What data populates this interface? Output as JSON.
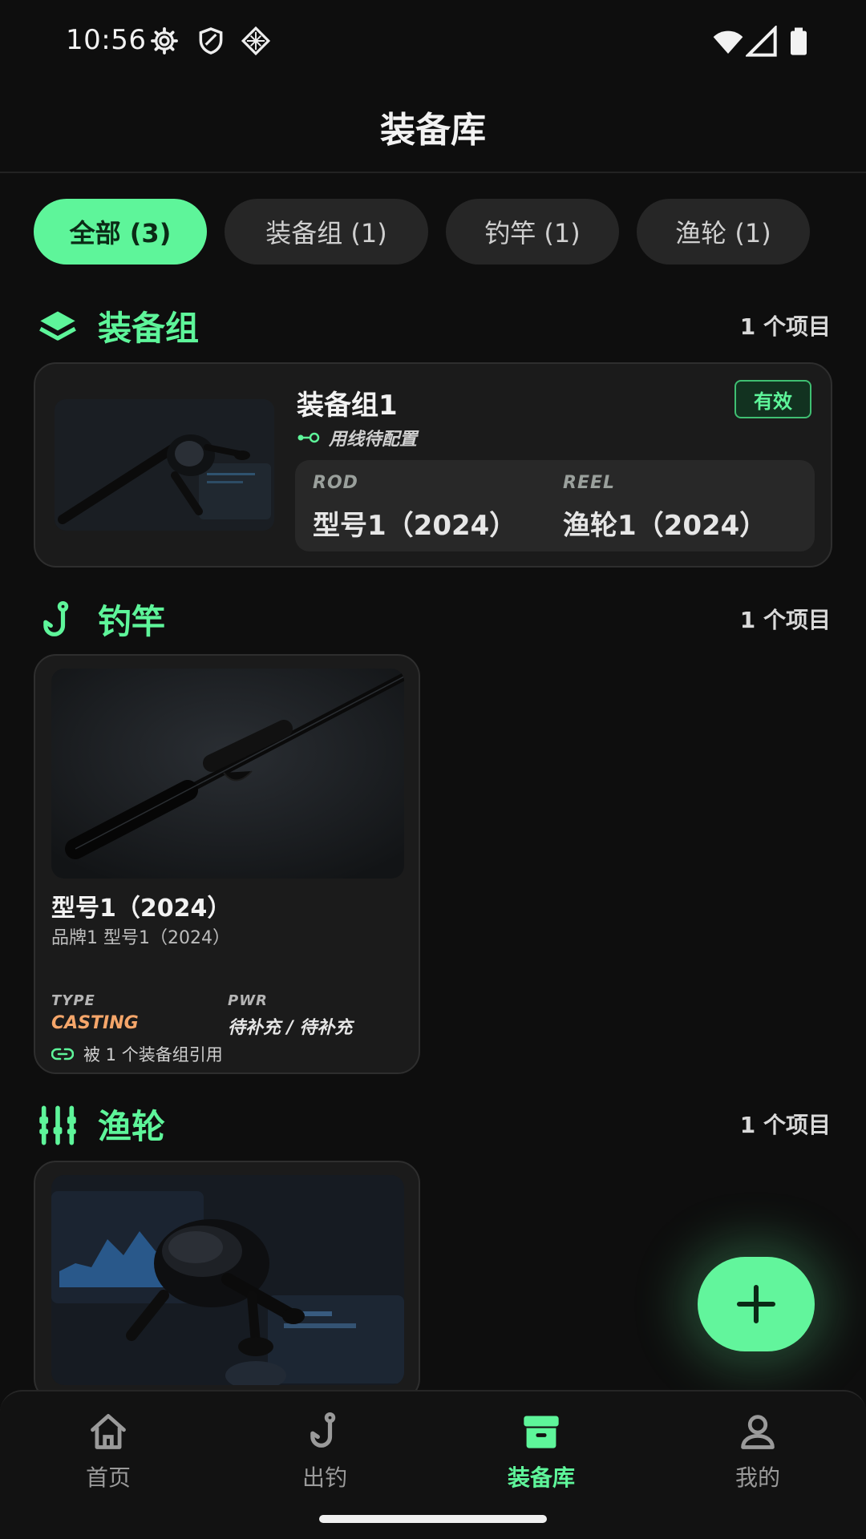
{
  "status_bar": {
    "time": "10:56",
    "icons": [
      "gear-icon",
      "shield-icon",
      "grid-diamond-icon",
      "wifi-icon",
      "signal-icon",
      "battery-icon"
    ]
  },
  "header": {
    "title": "装备库"
  },
  "filters": [
    {
      "label": "全部 (3)",
      "active": true
    },
    {
      "label": "装备组 (1)",
      "active": false
    },
    {
      "label": "钓竿 (1)",
      "active": false
    },
    {
      "label": "渔轮 (1)",
      "active": false
    }
  ],
  "sections": {
    "sets": {
      "title": "装备组",
      "count": "1 个项目",
      "icon": "layers-icon",
      "card": {
        "name": "装备组1",
        "badge": "有效",
        "line_status": "用线待配置",
        "rod_label": "ROD",
        "rod_value": "型号1（2024）",
        "reel_label": "REEL",
        "reel_value": "渔轮1（2024）"
      }
    },
    "rods": {
      "title": "钓竿",
      "count": "1 个项目",
      "icon": "hook-icon",
      "card": {
        "name": "型号1（2024）",
        "sub": "品牌1 型号1（2024）",
        "type_label": "TYPE",
        "type_value": "CASTING",
        "pwr_label": "PWR",
        "pwr_value": "待补充 / 待补充",
        "ref_text": "被 1 个装备组引用"
      }
    },
    "reels": {
      "title": "渔轮",
      "count": "1 个项目",
      "icon": "sliders-icon"
    }
  },
  "colors": {
    "accent": "#5ef59a",
    "background": "#0e0e0e",
    "card": "#1b1b1b",
    "type_value": "#f5a66a"
  },
  "fab": {
    "icon": "plus-icon"
  },
  "bottom_nav": [
    {
      "label": "首页",
      "icon": "home-icon",
      "active": false
    },
    {
      "label": "出钓",
      "icon": "hook-icon",
      "active": false
    },
    {
      "label": "装备库",
      "icon": "archive-icon",
      "active": true
    },
    {
      "label": "我的",
      "icon": "user-icon",
      "active": false
    }
  ]
}
